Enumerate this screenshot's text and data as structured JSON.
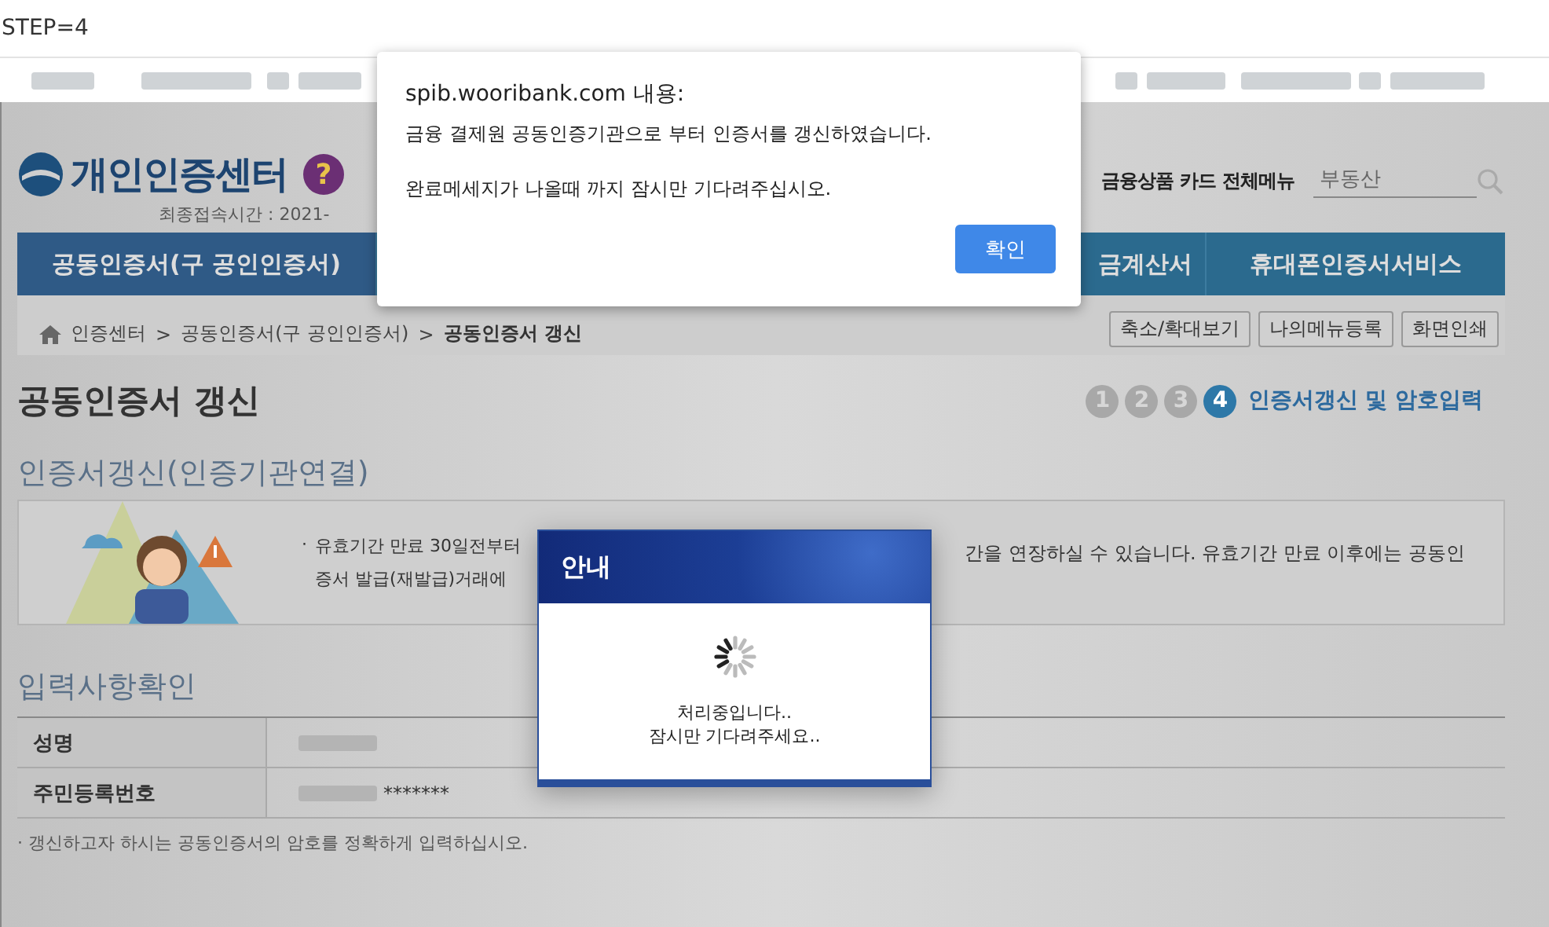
{
  "address_bar": {
    "text": "STEP=4"
  },
  "header": {
    "logo": "개인인증센터",
    "help": "?",
    "last_login": "최종접속시간 :  2021-",
    "links": [
      "금융상품",
      "카드",
      "전체메뉴"
    ],
    "search": {
      "placeholder": "부동산"
    }
  },
  "nav": {
    "tabs": [
      {
        "label": "공동인증서(구 공인인증서)"
      },
      {
        "label": "금계산서"
      },
      {
        "label": "휴대폰인증서서비스"
      }
    ]
  },
  "breadcrumb": {
    "separator": ">",
    "items": [
      "인증센터",
      "공동인증서(구 공인인증서)",
      "공동인증서 갱신"
    ]
  },
  "tool_buttons": [
    "축소/확대보기",
    "나의메뉴등록",
    "화면인쇄"
  ],
  "page_title": "공동인증서 갱신",
  "steps": [
    {
      "number": "1",
      "selected": false
    },
    {
      "number": "2",
      "selected": false
    },
    {
      "number": "3",
      "selected": false
    },
    {
      "number": "4",
      "selected": true
    }
  ],
  "step_label": "인증서갱신 및 암호입력",
  "section_title": "인증서갱신(인증기관연결)",
  "notice": {
    "bullet": "·",
    "left_lines": [
      "유효기간 만료 30일전부터",
      "증서 발급(재발급)거래에"
    ],
    "right_text": "간을 연장하실 수 있습니다. 유효기간 만료 이후에는 공동인"
  },
  "input_section": {
    "title": "입력사항확인",
    "rows": [
      {
        "label": "성명"
      },
      {
        "label": "주민등록번호",
        "value": "*******"
      }
    ]
  },
  "note": "· 갱신하고자 하시는 공동인증서의 암호를 정확하게 입력하십시오.",
  "alert": {
    "title": "spib.wooribank.com 내용:",
    "lines": [
      "금융 결제원 공동인증기관으로 부터 인증서를 갱신하였습니다.",
      "완료메세지가 나올때 까지 잠시만 기다려주십시오."
    ],
    "button": "확인"
  },
  "loading": {
    "title": "안내",
    "lines": [
      "처리중입니다..",
      "잠시만 기다려주세요.."
    ]
  }
}
